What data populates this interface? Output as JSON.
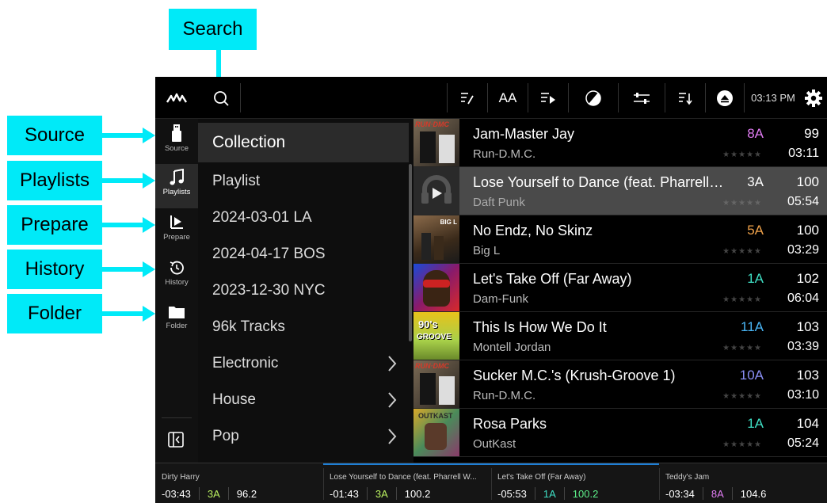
{
  "callouts": {
    "search": "Search",
    "source": "Source",
    "playlists": "Playlists",
    "prepare": "Prepare",
    "history": "History",
    "folder": "Folder"
  },
  "topbar": {
    "time": "03:13 PM",
    "logo_icon": "waveform-logo-icon",
    "search_icon": "search-icon",
    "edit_icon": "edit-list-icon",
    "font_label": "AA",
    "queue_icon": "play-queue-icon",
    "color_icon": "color-filter-icon",
    "sliders_icon": "sliders-icon",
    "sort_icon": "sort-icon",
    "eject_icon": "eject-icon",
    "settings_icon": "gear-icon"
  },
  "sidebar": {
    "items": [
      {
        "label": "Source",
        "icon": "usb-drive-icon"
      },
      {
        "label": "Playlists",
        "icon": "music-note-icon"
      },
      {
        "label": "Prepare",
        "icon": "prepare-icon"
      },
      {
        "label": "History",
        "icon": "history-icon"
      },
      {
        "label": "Folder",
        "icon": "folder-icon"
      }
    ],
    "collapse_icon": "collapse-panel-icon"
  },
  "list": {
    "items": [
      {
        "label": "Collection",
        "chevron": false
      },
      {
        "label": "Playlist",
        "chevron": false
      },
      {
        "label": "2024-03-01 LA",
        "chevron": false
      },
      {
        "label": "2024-04-17 BOS",
        "chevron": false
      },
      {
        "label": "2023-12-30 NYC",
        "chevron": false
      },
      {
        "label": "96k Tracks",
        "chevron": false
      },
      {
        "label": "Electronic",
        "chevron": true
      },
      {
        "label": "House",
        "chevron": true
      },
      {
        "label": "Pop",
        "chevron": true
      }
    ]
  },
  "tracks": [
    {
      "title": "Jam-Master Jay",
      "artist": "Run-D.M.C.",
      "key": "8A",
      "key_color": "#e07bf2",
      "bpm": "99",
      "time": "03:11",
      "stars": "★★★★★"
    },
    {
      "title": "Lose Yourself to Dance (feat. Pharrell Williams)",
      "artist": "Daft Punk",
      "key": "3A",
      "key_color": "#ffffff",
      "bpm": "100",
      "time": "05:54",
      "stars": "★★★★★"
    },
    {
      "title": "No Endz, No Skinz",
      "artist": "Big L",
      "key": "5A",
      "key_color": "#f0a24a",
      "bpm": "100",
      "time": "03:29",
      "stars": "★★★★★"
    },
    {
      "title": "Let's Take Off (Far Away)",
      "artist": "Dam-Funk",
      "key": "1A",
      "key_color": "#3fe0c5",
      "bpm": "102",
      "time": "06:04",
      "stars": "★★★★★"
    },
    {
      "title": "This Is How We Do It",
      "artist": "Montell Jordan",
      "key": "11A",
      "key_color": "#49b5f5",
      "bpm": "103",
      "time": "03:39",
      "stars": "★★★★★"
    },
    {
      "title": "Sucker M.C.'s (Krush-Groove 1)",
      "artist": "Run-D.M.C.",
      "key": "10A",
      "key_color": "#8a8ff5",
      "bpm": "103",
      "time": "03:10",
      "stars": "★★★★★"
    },
    {
      "title": "Rosa Parks",
      "artist": "OutKast",
      "key": "1A",
      "key_color": "#3fe0c5",
      "bpm": "104",
      "time": "05:24",
      "stars": "★★★★★"
    }
  ],
  "decks": [
    {
      "name": "Dirty Harry",
      "time": "-03:43",
      "key": "3A",
      "key_color": "#b9f060",
      "bpm": "96.2",
      "bpm_color": "#ffffff"
    },
    {
      "name": "Lose Yourself to Dance (feat. Pharrell W...",
      "time": "-01:43",
      "key": "3A",
      "key_color": "#b9f060",
      "bpm": "100.2",
      "bpm_color": "#ffffff"
    },
    {
      "name": "Let's Take Off (Far Away)",
      "time": "-05:53",
      "key": "1A",
      "key_color": "#3fe0c5",
      "bpm": "100.2",
      "bpm_color": "#5ef08a"
    },
    {
      "name": "Teddy's Jam",
      "time": "-03:34",
      "key": "8A",
      "key_color": "#e07bf2",
      "bpm": "104.6",
      "bpm_color": "#ffffff"
    }
  ]
}
